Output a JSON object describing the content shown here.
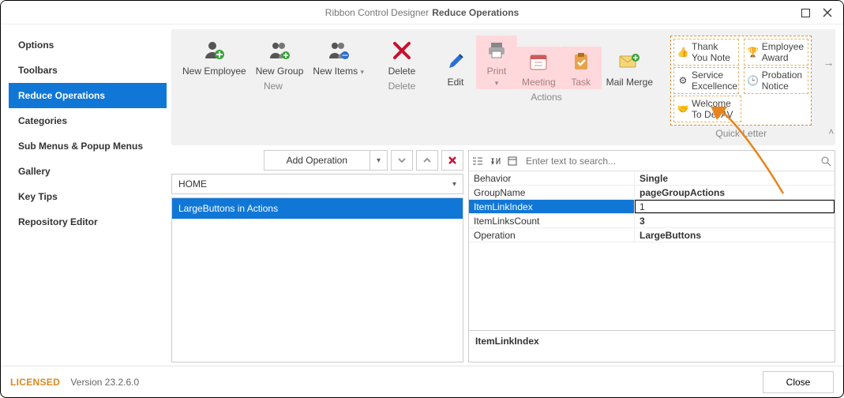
{
  "window": {
    "title_prefix": "Ribbon Control Designer",
    "title_bold": "Reduce Operations"
  },
  "sidebar": {
    "items": [
      {
        "label": "Options"
      },
      {
        "label": "Toolbars"
      },
      {
        "label": "Reduce Operations",
        "active": true
      },
      {
        "label": "Categories"
      },
      {
        "label": "Sub Menus & Popup Menus"
      },
      {
        "label": "Gallery"
      },
      {
        "label": "Key Tips"
      },
      {
        "label": "Repository Editor"
      }
    ]
  },
  "ribbon": {
    "groups": {
      "new": {
        "label": "New",
        "buttons": [
          {
            "label": "New Employee",
            "icon": "person-plus"
          },
          {
            "label": "New Group",
            "icon": "group-plus"
          },
          {
            "label": "New Items",
            "icon": "group-chat",
            "dropdown": true
          }
        ]
      },
      "delete": {
        "label": "Delete",
        "buttons": [
          {
            "label": "Delete",
            "icon": "x-red"
          }
        ]
      },
      "actions": {
        "label": "Actions",
        "buttons": [
          {
            "label": "Edit",
            "icon": "pencil-blue"
          },
          {
            "label": "Print",
            "icon": "printer",
            "pink": true,
            "dropdown": true
          },
          {
            "label": "Meeting",
            "icon": "calendar",
            "pink": true
          },
          {
            "label": "Task",
            "icon": "clipboard-check",
            "pink": true
          },
          {
            "label": "Mail Merge",
            "icon": "mail-plus"
          }
        ]
      },
      "quick_letter": {
        "label": "Quick Letter",
        "items": [
          {
            "label": "Thank You Note",
            "icon": "thumbs-up"
          },
          {
            "label": "Employee Award",
            "icon": "trophy"
          },
          {
            "label": "Service Excellence",
            "icon": "gear"
          },
          {
            "label": "Probation Notice",
            "icon": "clock"
          },
          {
            "label": "Welcome To DevAV",
            "icon": "handshake"
          }
        ]
      }
    }
  },
  "ops_bar": {
    "add_operation": "Add Operation"
  },
  "category_dropdown": {
    "value": "HOME"
  },
  "ops_list": [
    {
      "label": "LargeButtons in Actions",
      "selected": true
    }
  ],
  "search": {
    "placeholder": "Enter text to search..."
  },
  "props": [
    {
      "key": "Behavior",
      "value": "Single"
    },
    {
      "key": "GroupName",
      "value": "pageGroupActions"
    },
    {
      "key": "ItemLinkIndex",
      "value": "1",
      "selected": true
    },
    {
      "key": "ItemLinksCount",
      "value": "3"
    },
    {
      "key": "Operation",
      "value": "LargeButtons"
    }
  ],
  "prop_desc": "ItemLinkIndex",
  "footer": {
    "licensed": "LICENSED",
    "version": "Version 23.2.6.0",
    "close": "Close"
  }
}
